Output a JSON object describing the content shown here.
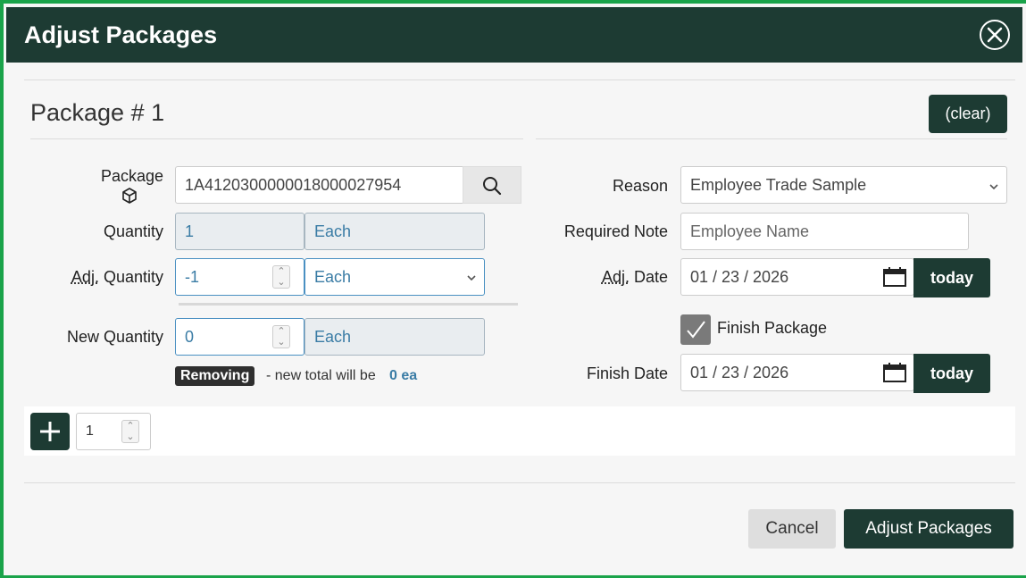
{
  "dialog": {
    "title": "Adjust Packages"
  },
  "package": {
    "heading": "Package # 1",
    "clear_label": "(clear)",
    "package_label": "Package",
    "package_value": "1A4120300000018000027954",
    "quantity_label": "Quantity",
    "quantity_value": "1",
    "quantity_unit": "Each",
    "adj_quantity_label_abbr": "Adj.",
    "adj_quantity_label_rest": " Quantity",
    "adj_quantity_value": "-1",
    "adj_quantity_unit": "Each",
    "new_quantity_label": "New Quantity",
    "new_quantity_value": "0",
    "new_quantity_unit": "Each",
    "removing_badge": "Removing",
    "removing_text": "- new total will be",
    "removing_total": "0 ea"
  },
  "right": {
    "reason_label": "Reason",
    "reason_value": "Employee Trade Sample",
    "required_note_label": "Required Note",
    "required_note_value": "Employee Name",
    "adj_date_label_abbr": "Adj.",
    "adj_date_label_rest": " Date",
    "adj_date_value": "01 / 23 / 2026",
    "today_label": "today",
    "finish_package_label": "Finish Package",
    "finish_package_checked": true,
    "finish_date_label": "Finish Date",
    "finish_date_value": "01 / 23 / 2026"
  },
  "add_row": {
    "count_value": "1"
  },
  "footer": {
    "cancel_label": "Cancel",
    "submit_label": "Adjust Packages"
  },
  "colors": {
    "header": "#1d3b33",
    "frame": "#1aa34a",
    "accent_text": "#3a7ca5"
  }
}
